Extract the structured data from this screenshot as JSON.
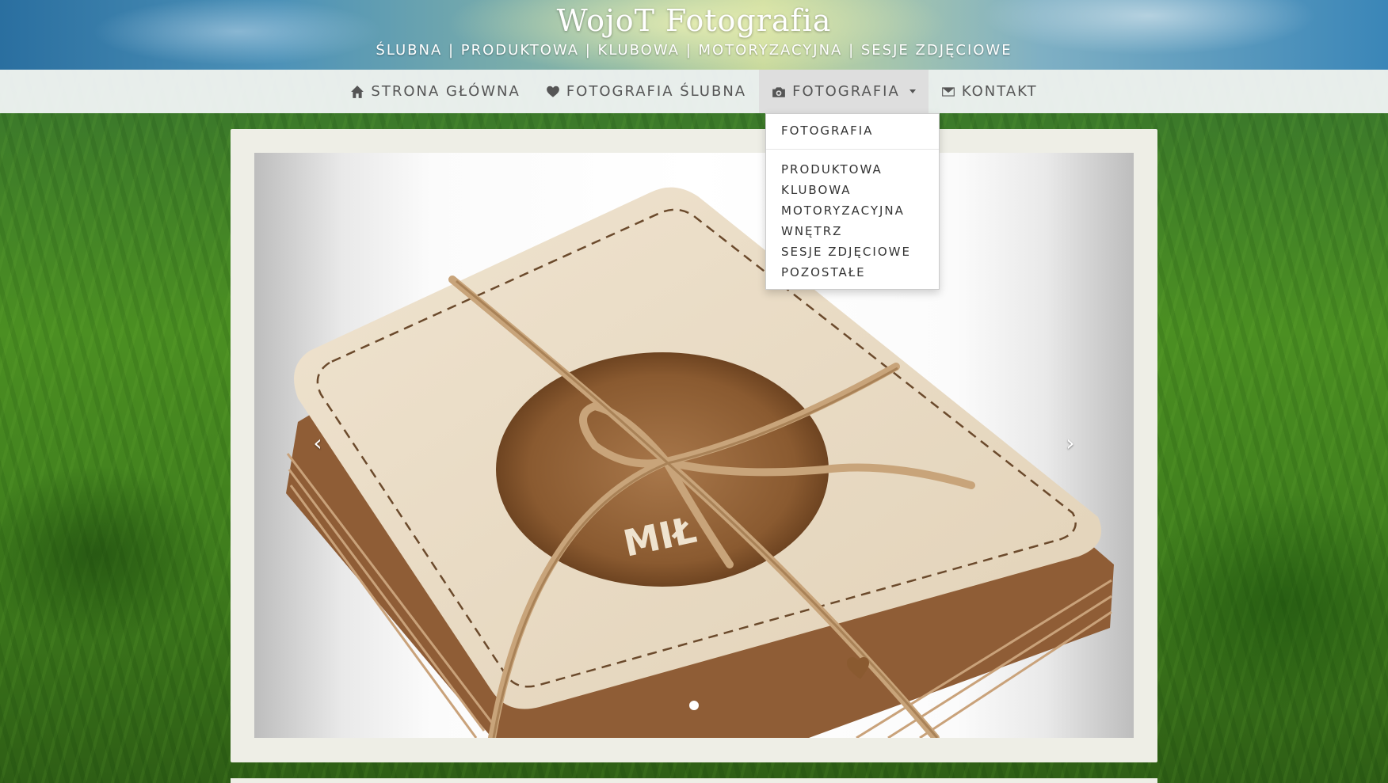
{
  "header": {
    "title": "WojoT Fotografia",
    "subtitle": "ŚLUBNA | PRODUKTOWA | KLUBOWA | MOTORYZACYJNA | SESJE ZDJĘCIOWE"
  },
  "nav": {
    "items": [
      {
        "label": "STRONA GŁÓWNA",
        "icon": "home-icon"
      },
      {
        "label": "FOTOGRAFIA ŚLUBNA",
        "icon": "heart-icon"
      },
      {
        "label": "FOTOGRAFIA",
        "icon": "camera-icon",
        "active": true,
        "has_dropdown": true
      },
      {
        "label": "KONTAKT",
        "icon": "envelope-icon"
      }
    ]
  },
  "dropdown": {
    "header_item": "FOTOGRAFIA",
    "items": [
      "PRODUKTOWA",
      "KLUBOWA",
      "MOTORYZACYJNA",
      "WNĘTRZ",
      "SESJE ZDJĘCIOWE",
      "POZOSTAŁE"
    ]
  },
  "carousel": {
    "prev_label": "‹",
    "next_label": "›",
    "slide_count": 1,
    "active_slide": 1,
    "photo_caption": "MIŁ"
  },
  "colors": {
    "nav_text": "#555555",
    "panel_bg": "#eeeee6",
    "nav_bg": "#f5f8fa"
  }
}
